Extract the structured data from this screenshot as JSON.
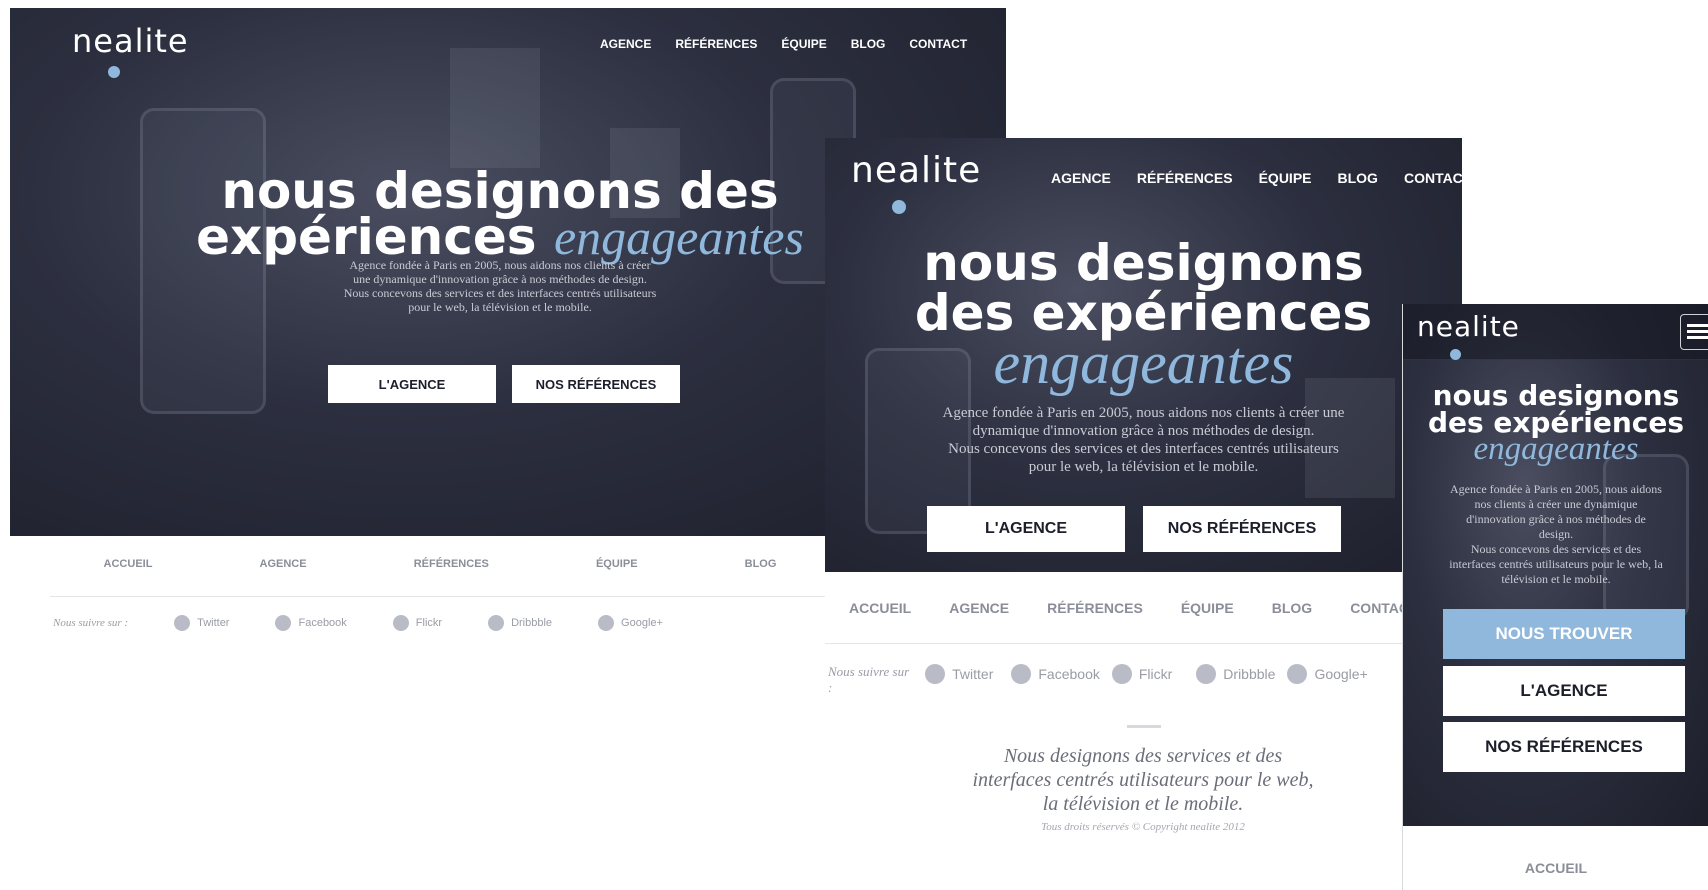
{
  "logo": "nealite",
  "nav": [
    "AGENCE",
    "RÉFÉRENCES",
    "ÉQUIPE",
    "BLOG",
    "CONTACT"
  ],
  "headline": {
    "desktop_line1": "nous designons des",
    "desktop_line2": "expériences",
    "tablet_line1": "nous designons",
    "tablet_line2": "des expériences",
    "mobile_line1": "nous designons",
    "mobile_line2": "des expériences",
    "emphasis": "engageantes"
  },
  "intro": {
    "desktop": [
      "Agence fondée à Paris en 2005, nous aidons nos clients à créer",
      "une dynamique d'innovation grâce à nos méthodes de design.",
      "Nous concevons des services et des interfaces centrés utilisateurs",
      "pour le web, la télévision et le mobile."
    ],
    "tablet": [
      "Agence fondée à Paris en 2005, nous aidons nos clients à créer une",
      "dynamique d'innovation grâce à nos méthodes de design.",
      "Nous concevons des services et des interfaces centrés utilisateurs",
      "pour le web, la télévision et le mobile."
    ],
    "mobile": [
      "Agence fondée à Paris en 2005, nous aidons",
      "nos clients à créer une dynamique",
      "d'innovation grâce à nos méthodes de",
      "design.",
      "Nous concevons des services et des",
      "interfaces centrés utilisateurs pour le web, la",
      "télévision et le mobile."
    ]
  },
  "buttons": {
    "agence": "L'AGENCE",
    "references": "NOS RÉFÉRENCES",
    "trouver": "NOUS TROUVER"
  },
  "footer_nav": [
    "ACCUEIL",
    "AGENCE",
    "RÉFÉRENCES",
    "ÉQUIPE",
    "BLOG",
    "CONTACT"
  ],
  "follow_label_desktop": "Nous suivre sur :",
  "follow_label_tablet_a": "Nous suivre sur",
  "follow_label_tablet_b": ":",
  "social": [
    "Twitter",
    "Facebook",
    "Flickr",
    "Dribbble",
    "Google+"
  ],
  "tagline": [
    "Nous designons des services et des",
    "interfaces centrés utilisateurs pour le web,",
    "la télévision et le mobile."
  ],
  "copyright": "Tous droits réservés © Copyright nealite 2012",
  "colors": {
    "accent": "#8fb8dc",
    "dark": "#1d1f2b",
    "muted": "#8b8e98"
  }
}
